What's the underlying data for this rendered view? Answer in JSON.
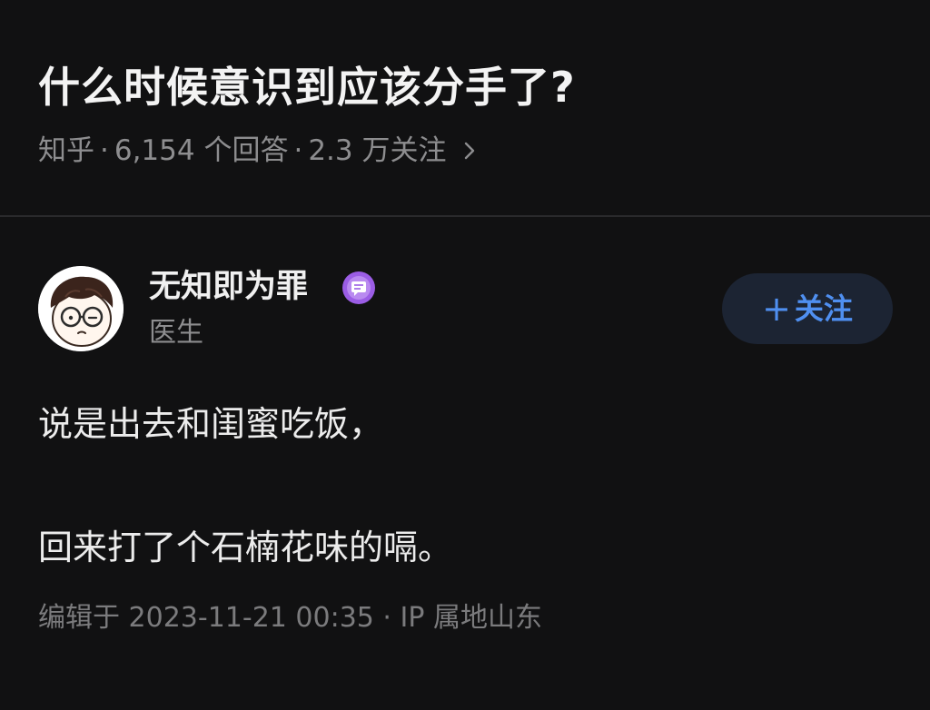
{
  "question": {
    "title": "什么时候意识到应该分手了?",
    "source": "知乎",
    "answers": "6,154 个回答",
    "followers": "2.3 万关注",
    "separator": "·"
  },
  "author": {
    "name": "无知即为罪",
    "title": "医生",
    "follow_plus": "+",
    "follow_label": "关注"
  },
  "content": {
    "lines": [
      "说是出去和闺蜜吃饭，",
      "回来打了个石楠花味的嗝。"
    ]
  },
  "footer": {
    "edit_info": "编辑于 2023-11-21 00:35 · IP 属地山东"
  },
  "icons": {
    "chevron": "chevron-right-icon",
    "badge": "message-badge-icon",
    "avatar": "cartoon-avatar"
  },
  "colors": {
    "background": "#111112",
    "accent": "#4f8ff0",
    "badge": "#9b5de5",
    "muted": "#8d8d8f"
  }
}
